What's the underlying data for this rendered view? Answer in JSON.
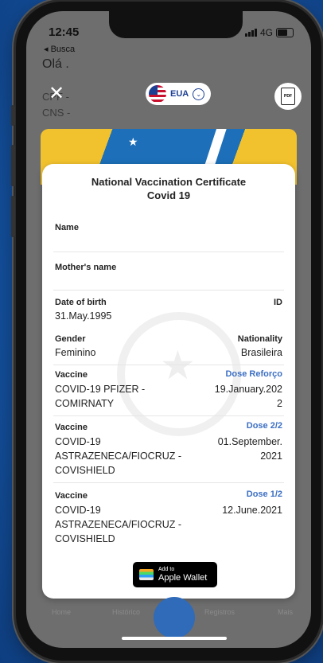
{
  "status": {
    "time": "12:45",
    "back": "◂ Busca",
    "network": "4G"
  },
  "app": {
    "greeting": "Olá .",
    "cpf": "CPF -",
    "cns": "CNS -",
    "country": "EUA",
    "tabs": [
      "Home",
      "Histórico",
      "Registros",
      "Mais"
    ]
  },
  "certificate": {
    "title_line1": "National Vaccination Certificate",
    "title_line2": "Covid 19",
    "name_label": "Name",
    "mother_label": "Mother's name",
    "dob_label": "Date of birth",
    "dob_value": "31.May.1995",
    "id_label": "ID",
    "gender_label": "Gender",
    "gender_value": "Feminino",
    "nationality_label": "Nationality",
    "nationality_value": "Brasileira",
    "vaccines": [
      {
        "label": "Vaccine",
        "dose": "Dose Reforço",
        "name_l1": "COVID-19 PFIZER -",
        "name_l2": "COMIRNATY",
        "name_l3": "",
        "date_l1": "19.January.202",
        "date_l2": "2"
      },
      {
        "label": "Vaccine",
        "dose": "Dose 2/2",
        "name_l1": "COVID-19",
        "name_l2": "ASTRAZENECA/FIOCRUZ -",
        "name_l3": "COVISHIELD",
        "date_l1": "01.September.",
        "date_l2": "2021"
      },
      {
        "label": "Vaccine",
        "dose": "Dose 1/2",
        "name_l1": "COVID-19",
        "name_l2": "ASTRAZENECA/FIOCRUZ -",
        "name_l3": "COVISHIELD",
        "date_l1": "12.June.2021",
        "date_l2": ""
      }
    ],
    "wallet_small": "Add to",
    "wallet_big": "Apple Wallet"
  }
}
